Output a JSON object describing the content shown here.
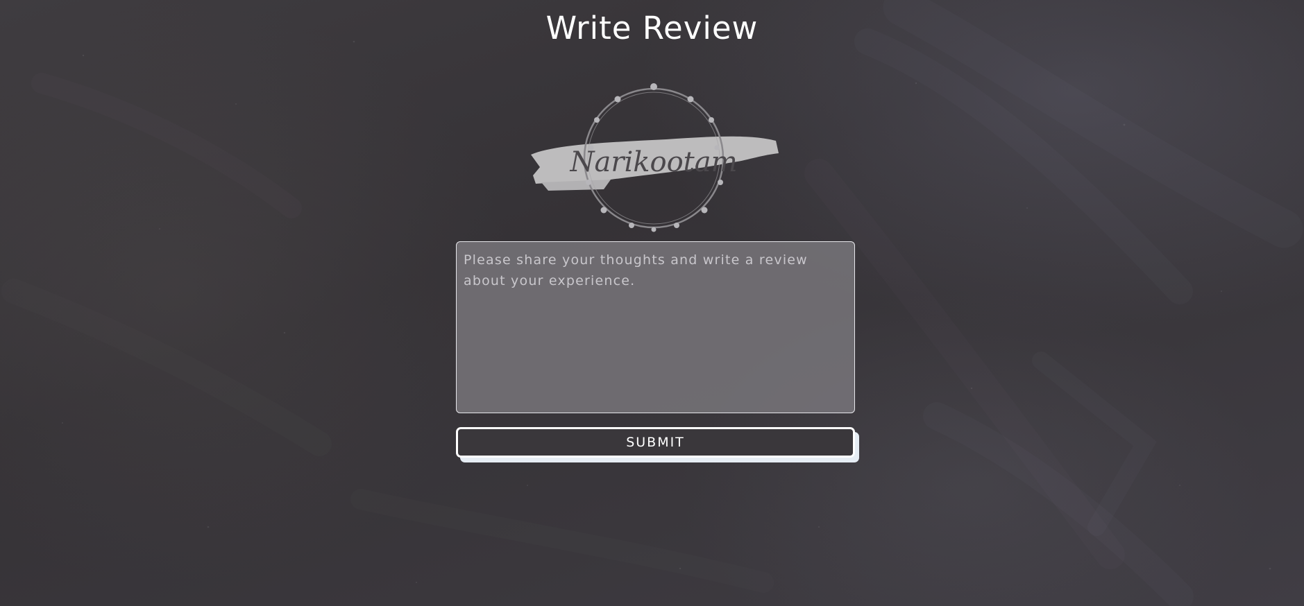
{
  "page": {
    "title": "Write Review",
    "background": "chalkboard-texture"
  },
  "logo": {
    "text": "Narikootam",
    "icon": "floral-wreath-logo"
  },
  "review": {
    "value": "",
    "placeholder": "Please share your thoughts and write a review about your experience."
  },
  "actions": {
    "submit_label": "SUBMIT"
  },
  "colors": {
    "text": "#ffffff",
    "button_shadow": "#e6edf4",
    "textarea_bg": "#7d7b80"
  }
}
